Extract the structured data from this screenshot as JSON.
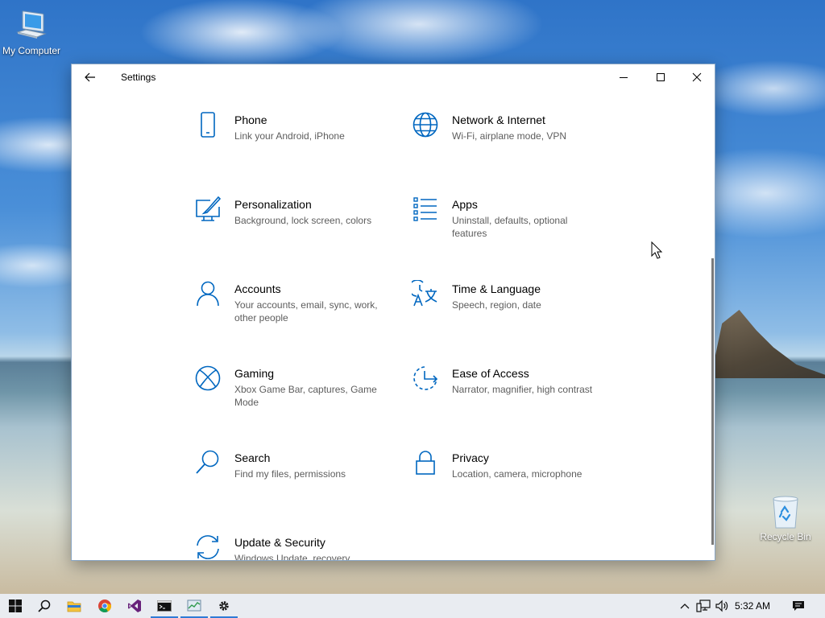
{
  "desktop": {
    "icons": [
      {
        "label": "My Computer",
        "icon": "computer-icon"
      },
      {
        "label": "Recycle Bin",
        "icon": "recycle-bin-icon"
      }
    ]
  },
  "window": {
    "title": "Settings",
    "accent": "#0067c0",
    "controls": [
      "minimize",
      "maximize",
      "close"
    ]
  },
  "settings": {
    "items": [
      {
        "name": "Phone",
        "desc": "Link your Android, iPhone",
        "icon": "phone-icon"
      },
      {
        "name": "Network & Internet",
        "desc": "Wi-Fi, airplane mode, VPN",
        "icon": "globe-icon"
      },
      {
        "name": "Personalization",
        "desc": "Background, lock screen, colors",
        "icon": "paint-monitor-icon"
      },
      {
        "name": "Apps",
        "desc": "Uninstall, defaults, optional features",
        "icon": "apps-list-icon"
      },
      {
        "name": "Accounts",
        "desc": "Your accounts, email, sync, work, other people",
        "icon": "person-icon"
      },
      {
        "name": "Time & Language",
        "desc": "Speech, region, date",
        "icon": "time-language-icon"
      },
      {
        "name": "Gaming",
        "desc": "Xbox Game Bar, captures, Game Mode",
        "icon": "xbox-icon"
      },
      {
        "name": "Ease of Access",
        "desc": "Narrator, magnifier, high contrast",
        "icon": "ease-of-access-icon"
      },
      {
        "name": "Search",
        "desc": "Find my files, permissions",
        "icon": "search-icon"
      },
      {
        "name": "Privacy",
        "desc": "Location, camera, microphone",
        "icon": "lock-icon"
      },
      {
        "name": "Update & Security",
        "desc": "Windows Update, recovery",
        "icon": "sync-icon"
      }
    ]
  },
  "taskbar": {
    "apps": [
      {
        "name": "Start",
        "icon": "windows-logo-icon"
      },
      {
        "name": "Search",
        "icon": "search-icon"
      },
      {
        "name": "File Explorer",
        "icon": "folder-icon"
      },
      {
        "name": "Chrome",
        "icon": "chrome-icon"
      },
      {
        "name": "Visual Studio",
        "icon": "visual-studio-icon"
      },
      {
        "name": "Command Prompt",
        "icon": "terminal-icon"
      },
      {
        "name": "Task Manager",
        "icon": "task-manager-icon"
      },
      {
        "name": "Settings",
        "icon": "gear-icon"
      }
    ],
    "clock": "5:32 AM"
  }
}
